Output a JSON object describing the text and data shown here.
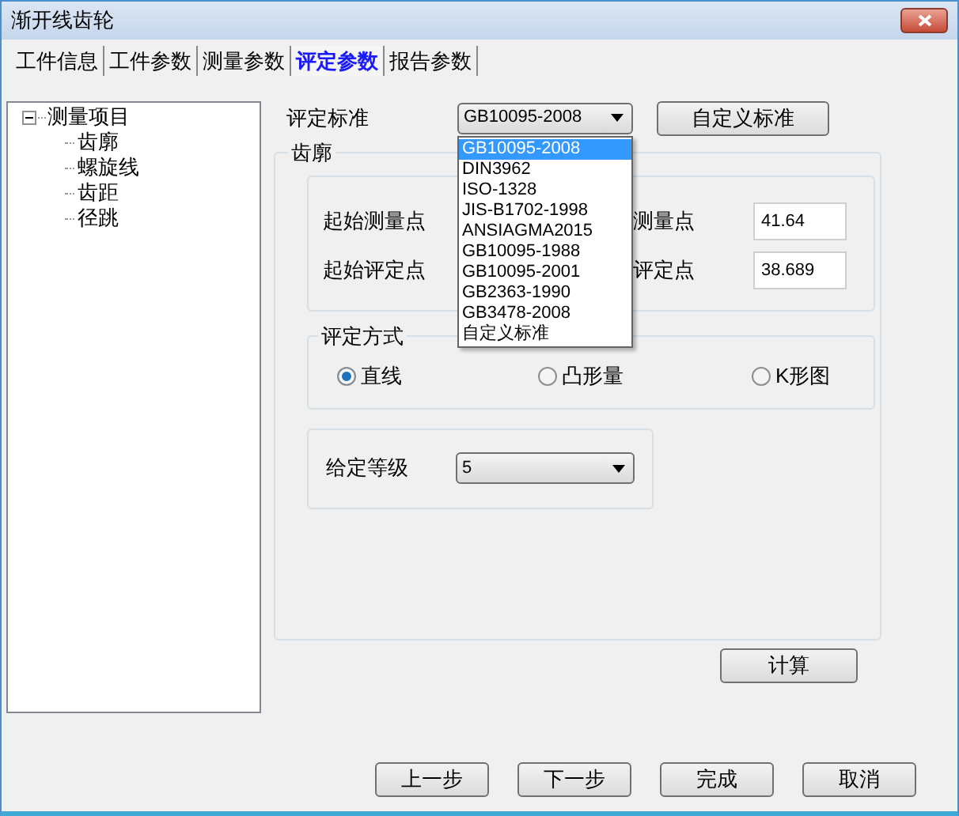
{
  "window": {
    "title": "渐开线齿轮"
  },
  "tabs": [
    {
      "label": "工件信息",
      "selected": false
    },
    {
      "label": "工件参数",
      "selected": false
    },
    {
      "label": "测量参数",
      "selected": false
    },
    {
      "label": "评定参数",
      "selected": true
    },
    {
      "label": "报告参数",
      "selected": false
    }
  ],
  "tree": {
    "label": "测量项目",
    "expanded": true,
    "children": [
      {
        "label": "齿廓"
      },
      {
        "label": "螺旋线"
      },
      {
        "label": "齿距"
      },
      {
        "label": "径跳"
      }
    ]
  },
  "standard": {
    "label": "评定标准",
    "value": "GB10095-2008",
    "open": true,
    "options": [
      {
        "label": "GB10095-2008",
        "selected": true
      },
      {
        "label": "DIN3962",
        "selected": false
      },
      {
        "label": "ISO-1328",
        "selected": false
      },
      {
        "label": "JIS-B1702-1998",
        "selected": false
      },
      {
        "label": "ANSIAGMA2015",
        "selected": false
      },
      {
        "label": "GB10095-1988",
        "selected": false
      },
      {
        "label": "GB10095-2001",
        "selected": false
      },
      {
        "label": "GB2363-1990",
        "selected": false
      },
      {
        "label": "GB3478-2008",
        "selected": false
      },
      {
        "label": "自定义标准",
        "selected": false
      }
    ]
  },
  "custom_button": "自定义标准",
  "profile": {
    "title": "齿廓",
    "rows": [
      {
        "label": "起始测量点",
        "right_label": "测量点",
        "value": "41.64"
      },
      {
        "label": "起始评定点",
        "right_label": "评定点",
        "value": "38.689"
      }
    ]
  },
  "method": {
    "title": "评定方式",
    "options": [
      {
        "label": "直线",
        "selected": true
      },
      {
        "label": "凸形量",
        "selected": false
      },
      {
        "label": "K形图",
        "selected": false
      }
    ]
  },
  "grade": {
    "label": "给定等级",
    "value": "5"
  },
  "calc_button": "计算",
  "buttons": [
    "上一步",
    "下一步",
    "完成",
    "取消"
  ]
}
